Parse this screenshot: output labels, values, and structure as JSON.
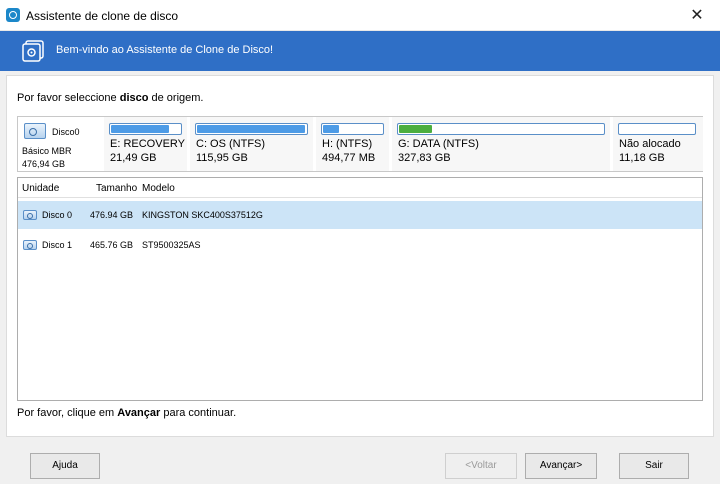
{
  "window": {
    "title": "Assistente de clone de disco",
    "close": "✕"
  },
  "banner": {
    "text": "Bem-vindo ao Assistente de Clone de Disco!"
  },
  "prompt": {
    "before": "Por favor seleccione ",
    "bold": "disco",
    "after": " de origem."
  },
  "disk_map": {
    "disk": {
      "name": "Disco0",
      "type": "Básico MBR",
      "size": "476,94 GB"
    },
    "partitions": [
      {
        "label": "E: RECOVERY ...",
        "capacity": "21,49 GB",
        "used_fraction": 0.85,
        "color": "#4d9be6"
      },
      {
        "label": "C: OS (NTFS)",
        "capacity": "115,95 GB",
        "used_fraction": 0.99,
        "color": "#4d9be6"
      },
      {
        "label": "H: (NTFS)",
        "capacity": "494,77 MB",
        "used_fraction": 0.3,
        "color": "#4d9be6"
      },
      {
        "label": "G: DATA (NTFS)",
        "capacity": "327,83 GB",
        "used_fraction": 0.17,
        "color": "#4cae3f"
      },
      {
        "label": "Não alocado",
        "capacity": "11,18 GB",
        "used_fraction": 0,
        "color": "#4d9be6"
      }
    ]
  },
  "table": {
    "headers": [
      "Unidade",
      "Tamanho",
      "Modelo"
    ],
    "rows": [
      {
        "unit": "Disco 0",
        "size": "476.94 GB",
        "model": "KINGSTON SKC400S37512G",
        "selected": true
      },
      {
        "unit": "Disco 1",
        "size": "465.76 GB",
        "model": "ST9500325AS",
        "selected": false
      }
    ]
  },
  "footer_msg": {
    "before": "Por favor, clique em ",
    "bold": "Avançar",
    "after": "  para continuar."
  },
  "buttons": {
    "help": "Ajuda",
    "back": "<Voltar",
    "next": "Avançar>",
    "exit": "Sair"
  }
}
